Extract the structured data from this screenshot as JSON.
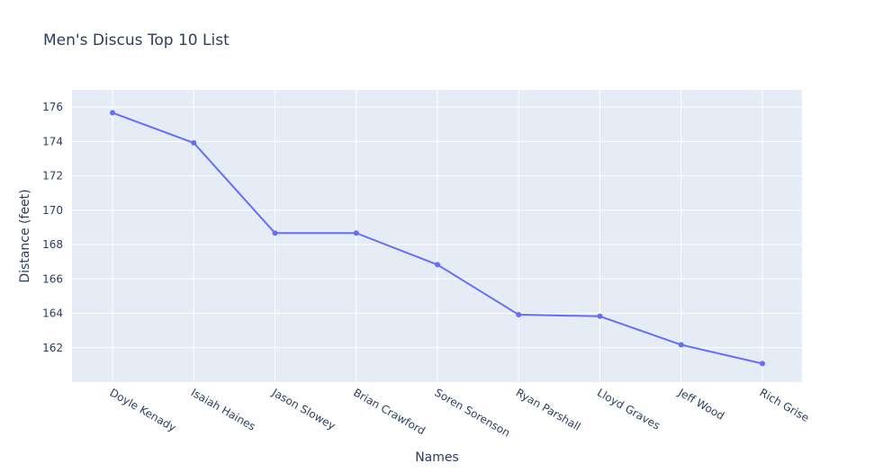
{
  "chart_data": {
    "type": "line",
    "title": "Men's Discus Top 10 List",
    "xlabel": "Names",
    "ylabel": "Distance (feet)",
    "categories": [
      "Doyle Kenady",
      "Isaiah Haines",
      "Jason Slowey",
      "Brian Crawford",
      "Soren Sorenson",
      "Ryan Parshall",
      "Lloyd Graves",
      "Jeff Wood",
      "Rich Grise"
    ],
    "series": [
      {
        "values": [
          175.67,
          173.92,
          168.67,
          168.67,
          166.83,
          163.92,
          163.83,
          162.17,
          161.08
        ]
      }
    ],
    "ylim": [
      160.0,
      177.0
    ],
    "yticks": [
      162,
      164,
      166,
      168,
      170,
      172,
      174,
      176
    ],
    "grid": true,
    "line_color": "#636efa",
    "plot_bg": "#e5ecf6"
  }
}
